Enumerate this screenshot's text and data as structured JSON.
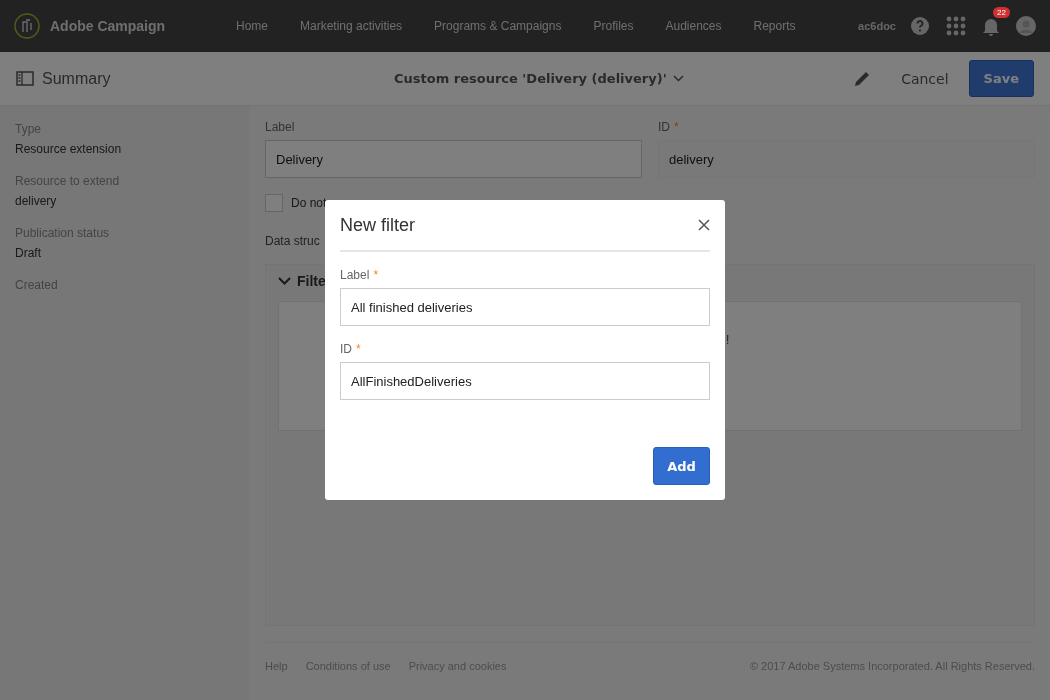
{
  "topbar": {
    "brand": "Adobe Campaign",
    "nav": [
      {
        "label": "Home",
        "selected": false
      },
      {
        "label": "Marketing activities",
        "selected": false
      },
      {
        "label": "Programs & Campaigns",
        "selected": false
      },
      {
        "label": "Profiles",
        "selected": false
      },
      {
        "label": "Audiences",
        "selected": false
      },
      {
        "label": "Reports",
        "selected": false
      }
    ],
    "user": "ac6doc",
    "notifications": "22"
  },
  "header": {
    "title": "Summary",
    "resource": "Custom resource 'Delivery (delivery)'",
    "cancel": "Cancel",
    "save": "Save"
  },
  "sidebar": {
    "fields": [
      {
        "label": "Type",
        "value": "Resource extension"
      },
      {
        "label": "Resource to extend",
        "value": "delivery"
      },
      {
        "label": "Publication status",
        "value": "Draft"
      },
      {
        "label": "Created"
      }
    ]
  },
  "form": {
    "label": {
      "label": "Label",
      "value": "Delivery"
    },
    "id": {
      "label": "ID",
      "required": "*",
      "value": "delivery"
    },
    "checkbox": {
      "label": "Do not",
      "checked": false
    },
    "section": "Data struc",
    "panel": {
      "title": "Filte",
      "expanded": true,
      "fragment": "!"
    }
  },
  "footer": {
    "links": [
      "Help",
      "Conditions of use",
      "Privacy and cookies"
    ],
    "copyright": "© 2017 Adobe Systems Incorporated. All Rights Reserved."
  },
  "dialog": {
    "title": "New filter",
    "fields": [
      {
        "label": "Label",
        "required": "*",
        "value": "All finished deliveries"
      },
      {
        "label": "ID",
        "required": "*",
        "value": "AllFinishedDeliveries"
      }
    ],
    "button": "Add"
  }
}
